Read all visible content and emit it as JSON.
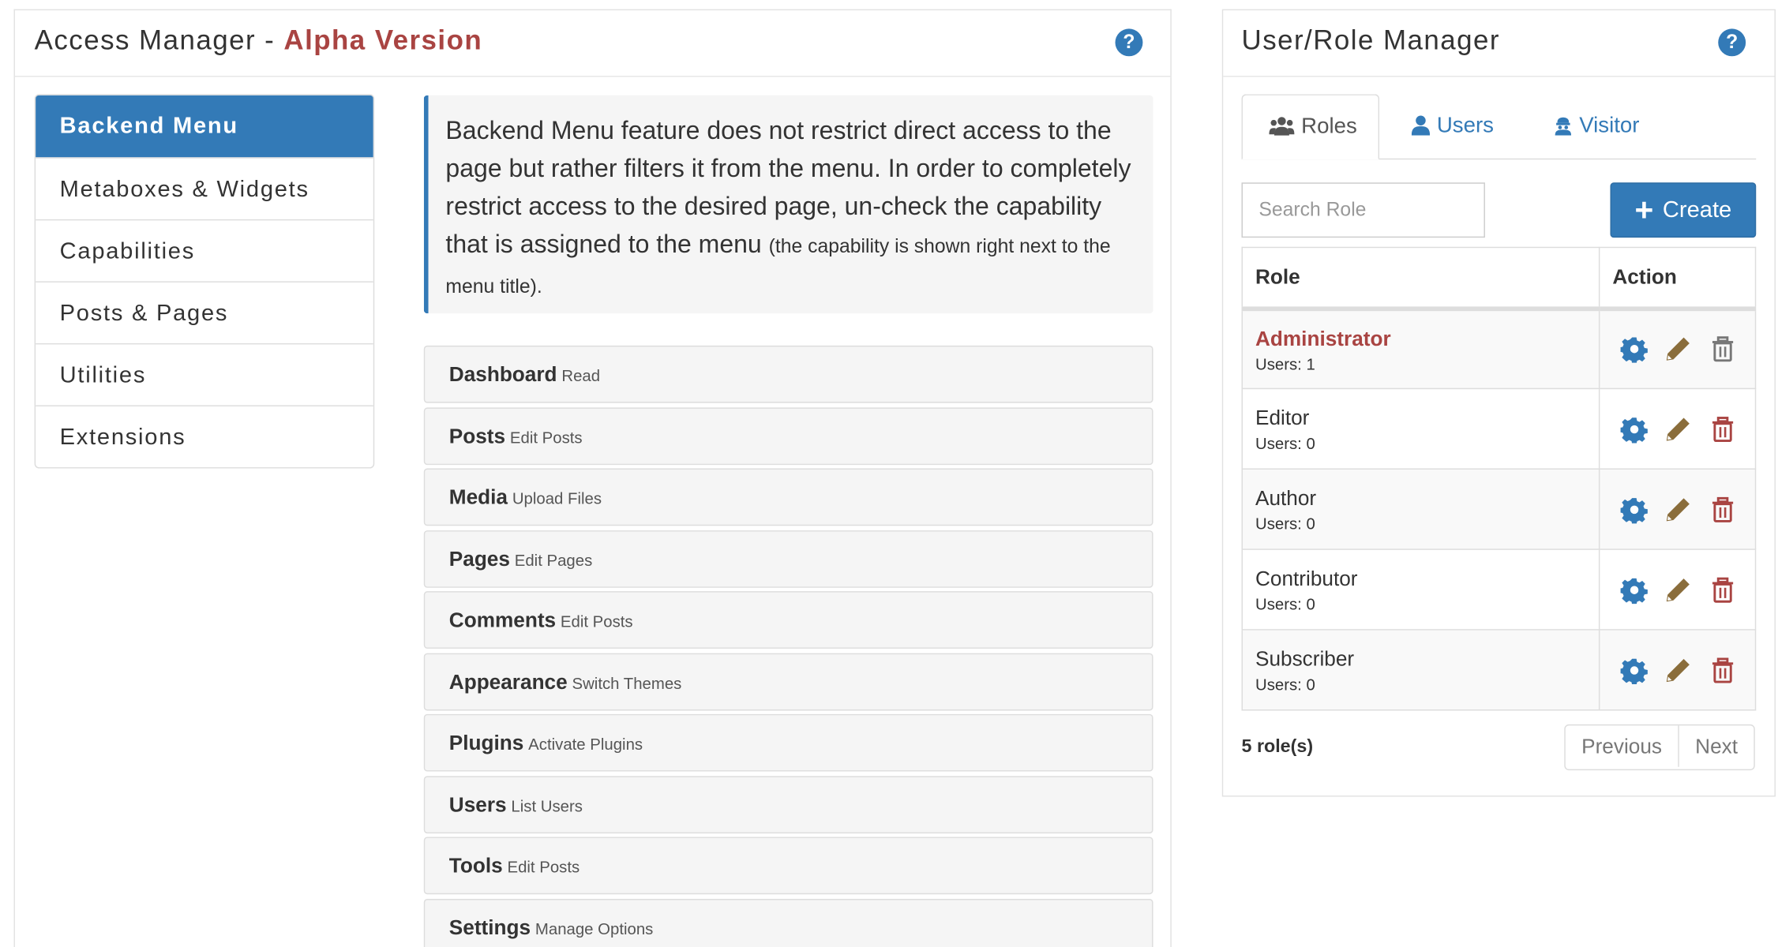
{
  "access_manager": {
    "title_prefix": "Access Manager - ",
    "title_version": "Alpha Version",
    "help": "?",
    "nav": [
      {
        "label": "Backend Menu",
        "active": true
      },
      {
        "label": "Metaboxes & Widgets",
        "active": false
      },
      {
        "label": "Capabilities",
        "active": false
      },
      {
        "label": "Posts & Pages",
        "active": false
      },
      {
        "label": "Utilities",
        "active": false
      },
      {
        "label": "Extensions",
        "active": false
      }
    ],
    "info_text": "Backend Menu feature does not restrict direct access to the page but rather filters it from the menu. In order to completely restrict access to the desired page, un-check the capability that is assigned to the menu",
    "info_note": "(the capability is shown right next to the menu title).",
    "menu_items": [
      {
        "name": "Dashboard",
        "cap": "Read"
      },
      {
        "name": "Posts",
        "cap": "Edit Posts"
      },
      {
        "name": "Media",
        "cap": "Upload Files"
      },
      {
        "name": "Pages",
        "cap": "Edit Pages"
      },
      {
        "name": "Comments",
        "cap": "Edit Posts"
      },
      {
        "name": "Appearance",
        "cap": "Switch Themes"
      },
      {
        "name": "Plugins",
        "cap": "Activate Plugins"
      },
      {
        "name": "Users",
        "cap": "List Users"
      },
      {
        "name": "Tools",
        "cap": "Edit Posts"
      },
      {
        "name": "Settings",
        "cap": "Manage Options"
      }
    ]
  },
  "user_role_manager": {
    "title": "User/Role Manager",
    "help": "?",
    "tabs": {
      "roles": "Roles",
      "users": "Users",
      "visitor": "Visitor"
    },
    "search_placeholder": "Search Role",
    "create_label": "Create",
    "table_headers": {
      "role": "Role",
      "action": "Action"
    },
    "roles": [
      {
        "name": "Administrator",
        "users": "Users: 1"
      },
      {
        "name": "Editor",
        "users": "Users: 0"
      },
      {
        "name": "Author",
        "users": "Users: 0"
      },
      {
        "name": "Contributor",
        "users": "Users: 0"
      },
      {
        "name": "Subscriber",
        "users": "Users: 0"
      }
    ],
    "count_label": "5 role(s)",
    "pager": {
      "previous": "Previous",
      "next": "Next"
    }
  },
  "colors": {
    "primary": "#337ab7",
    "danger": "#a94442",
    "edit": "#8a6d3b",
    "trash_disabled": "#777777"
  },
  "icons": [
    "question-circle-icon",
    "group-icon",
    "user-icon",
    "visitor-icon",
    "plus-icon",
    "gear-icon",
    "pencil-icon",
    "trash-icon"
  ]
}
